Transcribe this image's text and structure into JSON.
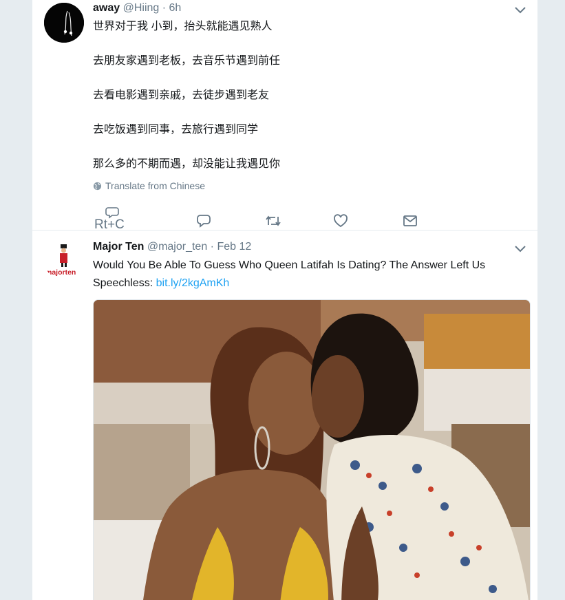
{
  "tweets": [
    {
      "name": "away",
      "handle": "@Hiing",
      "separator": "·",
      "time": "6h",
      "lines": [
        "世界对于我 小到，抬头就能遇见熟人",
        "去朋友家遇到老板，去音乐节遇到前任",
        "去看电影遇到亲戚，去徒步遇到老友",
        "去吃饭遇到同事，去旅行遇到同学",
        "那么多的不期而遇，却没能让我遇见你"
      ],
      "translate_label": "Translate from Chinese",
      "actions": {
        "rtc_label": "Rt+C",
        "icons": [
          "reply-icon",
          "retweet-icon",
          "like-icon",
          "dm-icon"
        ]
      }
    },
    {
      "name": "Major Ten",
      "handle": "@major_ten",
      "separator": "·",
      "time": "Feb 12",
      "text": "Would You Be Able To Guess Who Queen Latifah Is Dating? The Answer Left Us Speechless: ",
      "link": "bit.ly/2kgAmKh",
      "avatar_text": "majorten",
      "media": "photo"
    }
  ],
  "colors": {
    "background": "#e6ecf0",
    "text": "#14171a",
    "secondary": "#657786",
    "link": "#1da1f2"
  }
}
